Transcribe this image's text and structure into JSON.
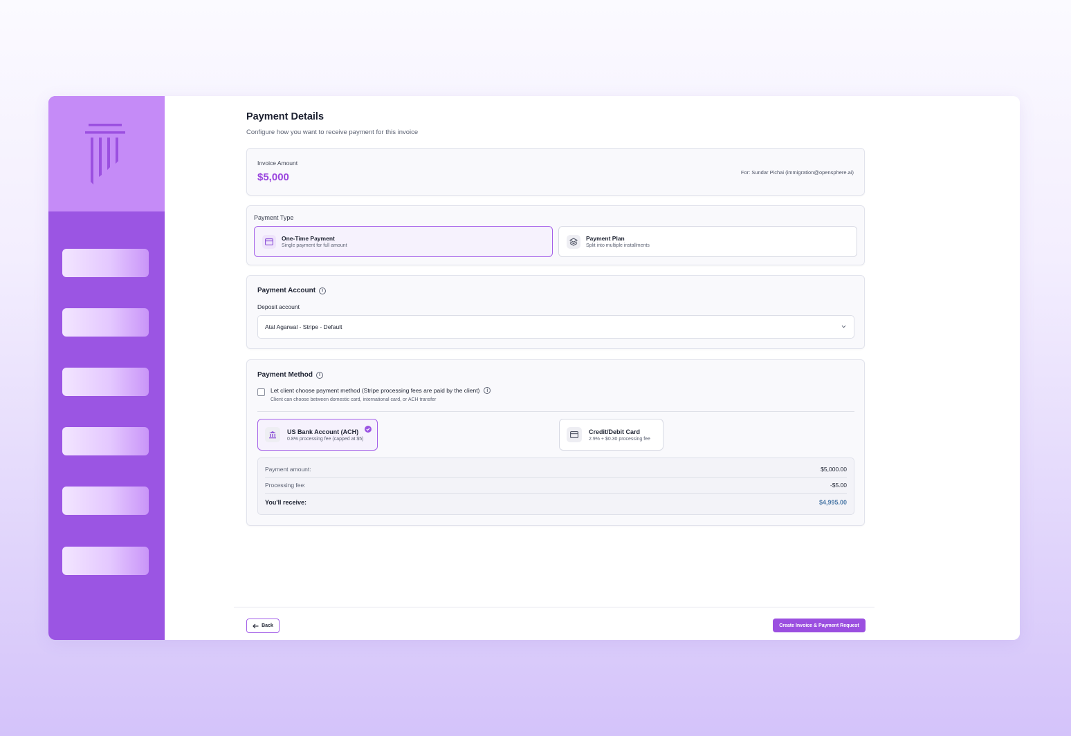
{
  "colors": {
    "accent": "#9b55e3",
    "accent_light": "#c58bf7",
    "amount": "#9a45de",
    "receive": "#4d7aa8",
    "selected_border": "#a35fe8"
  },
  "sidebar": {
    "logo": "pillar-logo-icon",
    "items": [
      {
        "label": ""
      },
      {
        "label": ""
      },
      {
        "label": ""
      },
      {
        "label": ""
      },
      {
        "label": ""
      },
      {
        "label": ""
      }
    ]
  },
  "header": {
    "title": "Payment Details",
    "subtitle": "Configure how you want to receive payment for this invoice"
  },
  "invoice": {
    "label": "Invoice Amount",
    "amount": "$5,000",
    "for_text": "For: Sundar Pichai (immigration@opensphere.ai)"
  },
  "payment_type": {
    "title": "Payment Type",
    "options": [
      {
        "title": "One-Time Payment",
        "subtitle": "Single payment for full amount",
        "icon": "credit-card-icon",
        "selected": true
      },
      {
        "title": "Payment Plan",
        "subtitle": "Split into multiple installments",
        "icon": "layers-icon",
        "selected": false
      }
    ]
  },
  "payment_account": {
    "title": "Payment Account",
    "deposit_label": "Deposit account",
    "selected": "Atal Agarwal - Stripe - Default"
  },
  "payment_method": {
    "title": "Payment Method",
    "let_client_label": "Let client choose payment method (Stripe processing fees are paid by the client)",
    "let_client_sub": "Client can choose between domestic card, international card, or ACH transfer",
    "let_client_checked": false,
    "methods": [
      {
        "title": "US Bank Account (ACH)",
        "subtitle": "0.8% processing fee (capped at $5)",
        "icon": "bank-icon",
        "selected": true
      },
      {
        "title": "Credit/Debit Card",
        "subtitle": "2.9% + $0.30 processing fee",
        "icon": "credit-card-icon",
        "selected": false
      }
    ]
  },
  "summary": {
    "payment_amount_label": "Payment amount:",
    "payment_amount": "$5,000.00",
    "processing_fee_label": "Processing fee:",
    "processing_fee": "-$5.00",
    "receive_label": "You'll receive:",
    "receive": "$4,995.00"
  },
  "footer": {
    "back_label": "Back",
    "create_label": "Create Invoice & Payment Request"
  }
}
